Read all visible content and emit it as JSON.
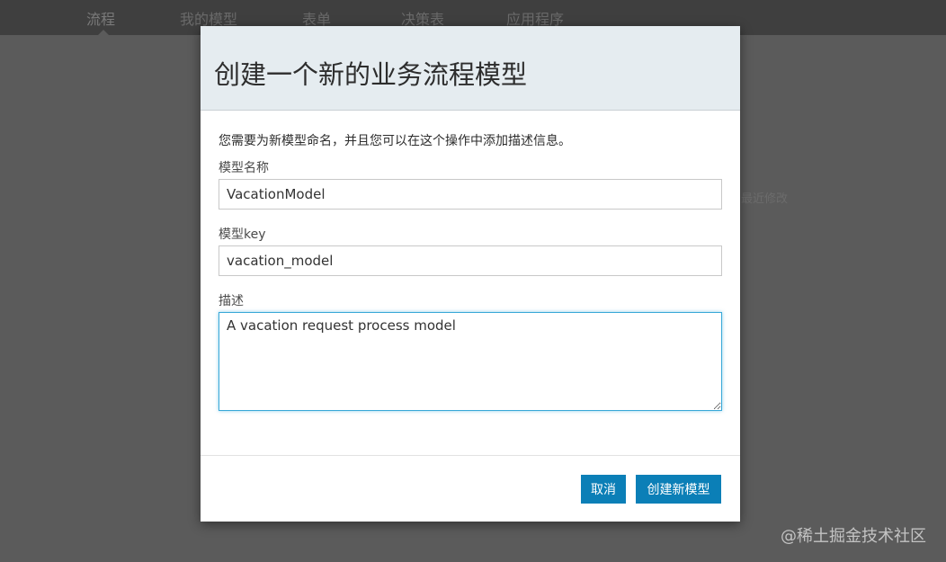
{
  "background": {
    "nav_items": [
      "流程",
      "我的模型",
      "表单",
      "决策表",
      "应用程序"
    ],
    "side_text": "最近修改"
  },
  "dialog": {
    "title": "创建一个新的业务流程模型",
    "intro": "您需要为新模型命名，并且您可以在这个操作中添加描述信息。",
    "name_label": "模型名称",
    "name_value": "VacationModel",
    "key_label": "模型key",
    "key_value": "vacation_model",
    "desc_label": "描述",
    "desc_value": "A vacation request process model",
    "cancel_label": "取消",
    "create_label": "创建新模型"
  },
  "watermark": "@稀土掘金技术社区",
  "colors": {
    "overlay": "#5b5b5b",
    "header_bg": "#e5ecf0",
    "primary_button": "#0b7fb7",
    "focus_border": "#38a8d8"
  }
}
